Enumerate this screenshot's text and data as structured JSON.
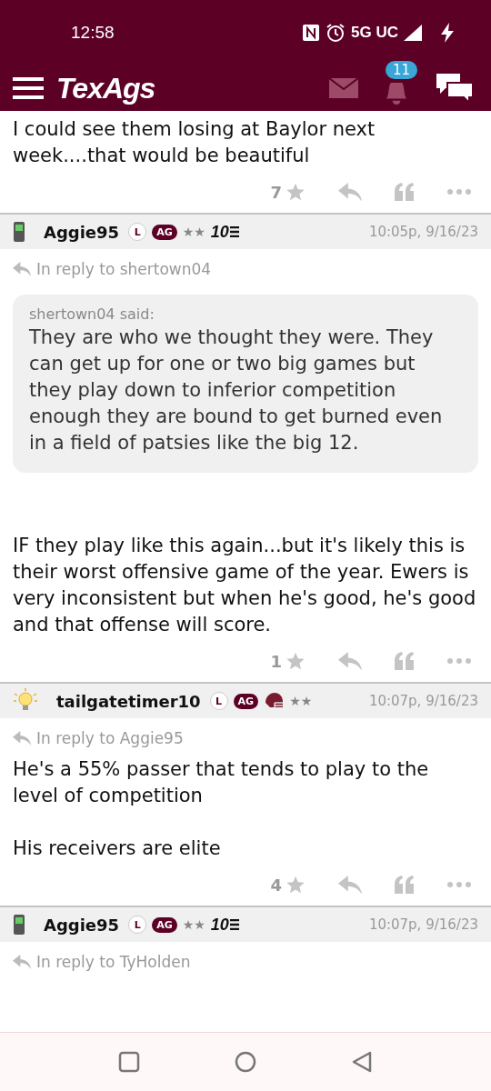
{
  "status_bar": {
    "time": "12:58",
    "network": "5G UC"
  },
  "header": {
    "logo": "TexAgs",
    "notification_count": "11"
  },
  "posts": [
    {
      "body": [
        "I could see them losing at Baylor next week....that would be beautiful"
      ],
      "likes": "7"
    },
    {
      "author": {
        "name": "Aggie95",
        "avatar": {
          "kind": "phone"
        },
        "badges": [
          {
            "kind": "circle",
            "text": "L"
          },
          {
            "kind": "pill",
            "text": "AG"
          },
          {
            "kind": "stars",
            "text": "★★"
          },
          {
            "kind": "rank",
            "text": "10"
          }
        ]
      },
      "time": "10:05p, 9/16/23",
      "reply_to": "In reply to shertown04",
      "quote": {
        "by": "shertown04 said:",
        "text": "They are who we thought they were. They can get up for one or two big games but they play down to inferior competition enough they are bound to get burned even in a field of patsies like the big 12."
      },
      "body": [
        "IF they play like this again...but it's likely this is their worst offensive game of the year. Ewers is very inconsistent but when he's good, he's good and that offense will score."
      ],
      "likes": "1"
    },
    {
      "author": {
        "name": "tailgatetimer10",
        "avatar": {
          "kind": "bulb"
        },
        "badges": [
          {
            "kind": "circle",
            "text": "L"
          },
          {
            "kind": "pill",
            "text": "AG"
          },
          {
            "kind": "helmet"
          },
          {
            "kind": "stars",
            "text": "★★"
          }
        ]
      },
      "time": "10:07p, 9/16/23",
      "reply_to": "In reply to Aggie95",
      "body": [
        "He's a 55% passer that tends to play to the level of competition",
        "His receivers are elite"
      ],
      "likes": "4"
    },
    {
      "author": {
        "name": "Aggie95",
        "avatar": {
          "kind": "phone"
        },
        "badges": [
          {
            "kind": "circle",
            "text": "L"
          },
          {
            "kind": "pill",
            "text": "AG"
          },
          {
            "kind": "stars",
            "text": "★★"
          },
          {
            "kind": "rank",
            "text": "10"
          }
        ]
      },
      "time": "10:07p, 9/16/23",
      "reply_to": "In reply to TyHolden"
    }
  ]
}
